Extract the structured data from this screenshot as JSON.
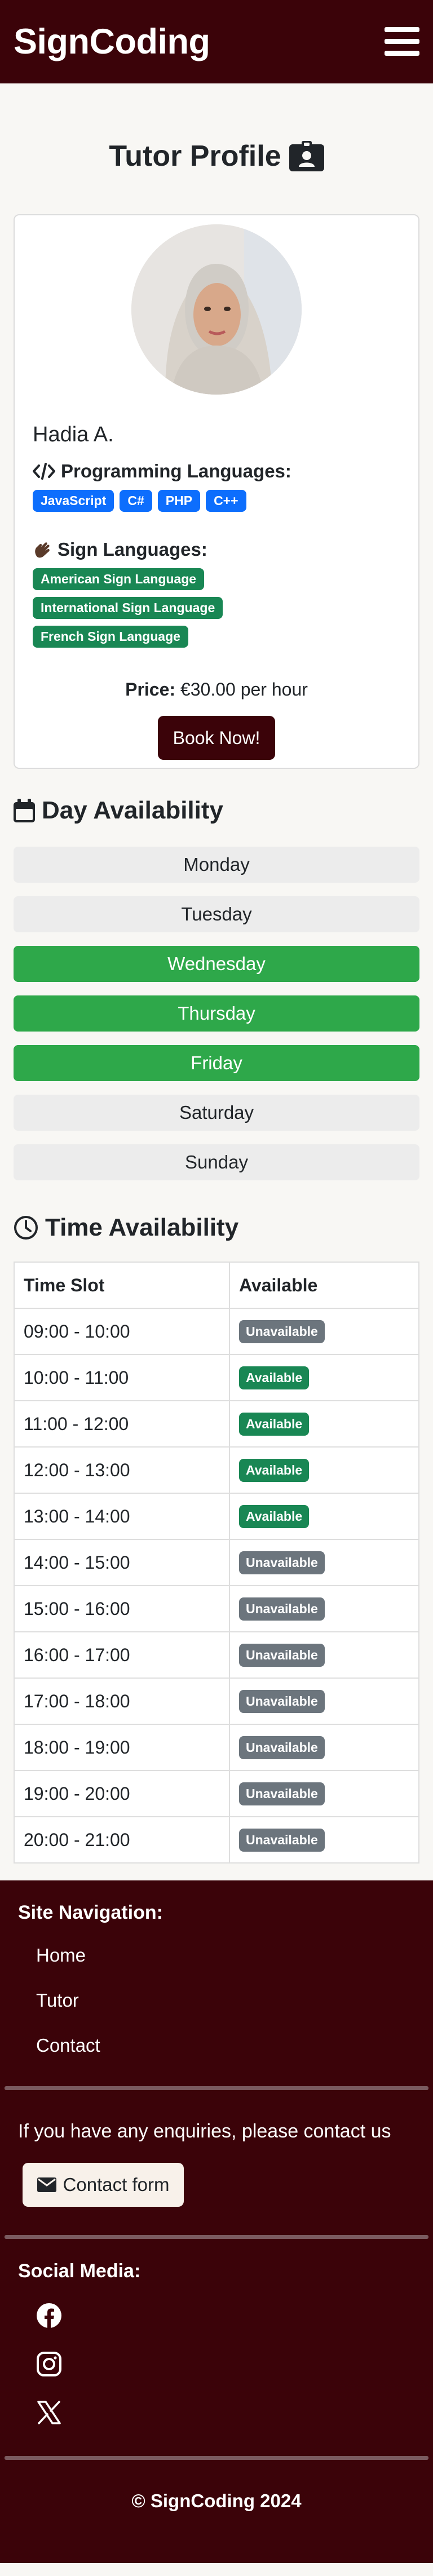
{
  "header": {
    "brand": "SignCoding",
    "menu_icon": "hamburger-menu-icon"
  },
  "page": {
    "title": "Tutor Profile",
    "title_icon": "id-badge-icon"
  },
  "tutor": {
    "name": "Hadia A.",
    "programming_heading": "Programming Languages:",
    "programming_icon": "code-icon",
    "programming_languages": [
      "JavaScript",
      "C#",
      "PHP",
      "C++"
    ],
    "sign_heading": "Sign Languages:",
    "sign_icon": "hand-sign-icon",
    "sign_languages": [
      "American Sign Language",
      "International Sign Language",
      "French Sign Language"
    ],
    "price_label": "Price:",
    "price_value": "€30.00 per hour",
    "book_label": "Book Now!"
  },
  "day_availability": {
    "heading": "Day Availability",
    "icon": "calendar-icon",
    "days": [
      {
        "label": "Monday",
        "available": false
      },
      {
        "label": "Tuesday",
        "available": false
      },
      {
        "label": "Wednesday",
        "available": true
      },
      {
        "label": "Thursday",
        "available": true
      },
      {
        "label": "Friday",
        "available": true
      },
      {
        "label": "Saturday",
        "available": false
      },
      {
        "label": "Sunday",
        "available": false
      }
    ]
  },
  "time_availability": {
    "heading": "Time Availability",
    "icon": "clock-icon",
    "columns": [
      "Time Slot",
      "Available"
    ],
    "rows": [
      {
        "slot": "09:00 - 10:00",
        "status": "Unavailable"
      },
      {
        "slot": "10:00 - 11:00",
        "status": "Available"
      },
      {
        "slot": "11:00 - 12:00",
        "status": "Available"
      },
      {
        "slot": "12:00 - 13:00",
        "status": "Available"
      },
      {
        "slot": "13:00 - 14:00",
        "status": "Available"
      },
      {
        "slot": "14:00 - 15:00",
        "status": "Unavailable"
      },
      {
        "slot": "15:00 - 16:00",
        "status": "Unavailable"
      },
      {
        "slot": "16:00 - 17:00",
        "status": "Unavailable"
      },
      {
        "slot": "17:00 - 18:00",
        "status": "Unavailable"
      },
      {
        "slot": "18:00 - 19:00",
        "status": "Unavailable"
      },
      {
        "slot": "19:00 - 20:00",
        "status": "Unavailable"
      },
      {
        "slot": "20:00 - 21:00",
        "status": "Unavailable"
      }
    ]
  },
  "footer": {
    "nav_heading": "Site Navigation:",
    "nav_links": [
      "Home",
      "Tutor",
      "Contact"
    ],
    "enquiry_text": "If you have any enquiries, please contact us",
    "contact_label": "Contact form",
    "social_heading": "Social Media:",
    "social_icons": [
      "facebook-icon",
      "instagram-icon",
      "x-icon"
    ],
    "copyright": "© SignCoding 2024"
  },
  "colors": {
    "brand": "#3b0309",
    "available_green": "#2ea84a",
    "badge_green": "#198754",
    "badge_gray": "#6c757d",
    "tag_blue": "#0d6efd"
  }
}
